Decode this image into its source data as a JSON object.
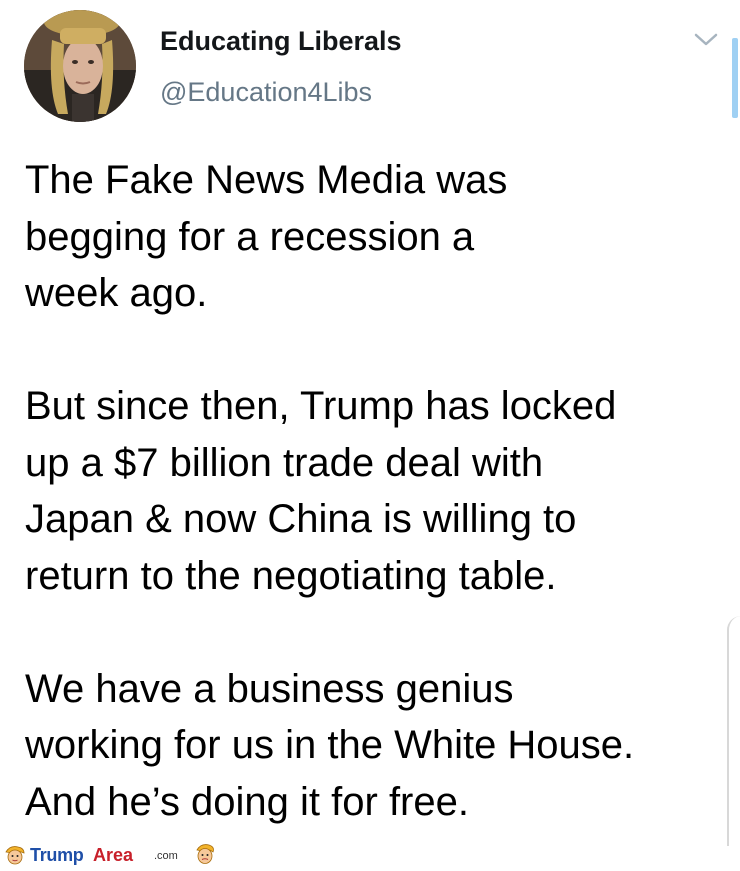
{
  "author": {
    "display_name": "Educating Liberals",
    "handle": "@Education4Libs"
  },
  "tweet": {
    "paragraphs": [
      {
        "lines": [
          "The Fake News Media was",
          "begging for a recession a",
          "week ago."
        ]
      },
      {
        "lines": [
          "But since then, Trump has locked",
          "up a $7 billion trade deal with",
          "Japan & now China is willing to",
          "return to the negotiating table."
        ]
      },
      {
        "lines": [
          "We have a business genius",
          "working for us in the White House.",
          "And he’s doing it for free."
        ]
      }
    ]
  },
  "watermark": {
    "brand_part1": "Trump",
    "brand_part2": "Area",
    "suffix": ".com"
  },
  "colors": {
    "handle_gray": "#657786",
    "accent_blue": "#1da1f2",
    "watermark_blue": "#1f4fa8",
    "watermark_red": "#c8202a"
  },
  "icons": {
    "menu": "chevron-down-icon",
    "watermark_mascot": "trump-caricature-icon"
  }
}
